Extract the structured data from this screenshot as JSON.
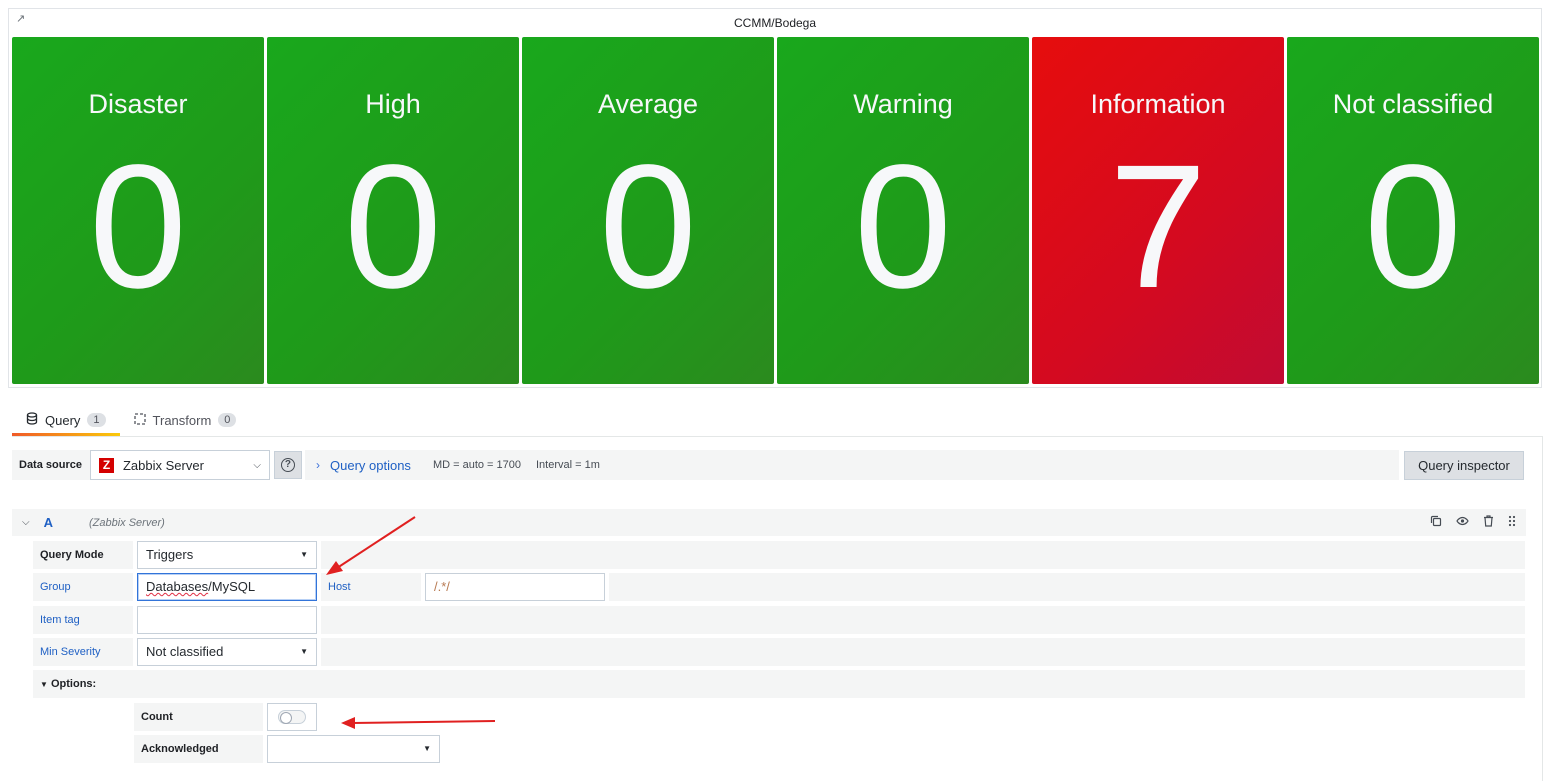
{
  "panel": {
    "title": "CCMM/Bodega",
    "tiles": [
      {
        "label": "Disaster",
        "value": "0",
        "color": "#1fa01c"
      },
      {
        "label": "High",
        "value": "0",
        "color": "#1fa01c"
      },
      {
        "label": "Average",
        "value": "0",
        "color": "#1fa01c"
      },
      {
        "label": "Warning",
        "value": "0",
        "color": "#1fa01c"
      },
      {
        "label": "Information",
        "value": "7",
        "color": "#d40a20"
      },
      {
        "label": "Not classified",
        "value": "0",
        "color": "#1fa01c"
      }
    ]
  },
  "tabs": {
    "query_label": "Query",
    "query_count": "1",
    "transform_label": "Transform",
    "transform_count": "0"
  },
  "datasource": {
    "label": "Data source",
    "selected": "Zabbix Server",
    "logo_letter": "Z",
    "query_options_label": "Query options",
    "md_info": "MD = auto = 1700",
    "interval_info": "Interval = 1m",
    "inspector_label": "Query inspector"
  },
  "query_a": {
    "letter": "A",
    "datasource_name": "(Zabbix Server)",
    "fields": {
      "query_mode_label": "Query Mode",
      "query_mode_value": "Triggers",
      "group_label": "Group",
      "group_value_word": "Databases",
      "group_value_rest": "/MySQL",
      "host_label": "Host",
      "host_placeholder": "/.*/",
      "item_tag_label": "Item tag",
      "item_tag_value": "",
      "min_severity_label": "Min Severity",
      "min_severity_value": "Not classified",
      "options_label": "Options:",
      "count_label": "Count",
      "count_enabled": false,
      "acknowledged_label": "Acknowledged",
      "acknowledged_value": ""
    }
  },
  "annotation_color": "#e02020"
}
